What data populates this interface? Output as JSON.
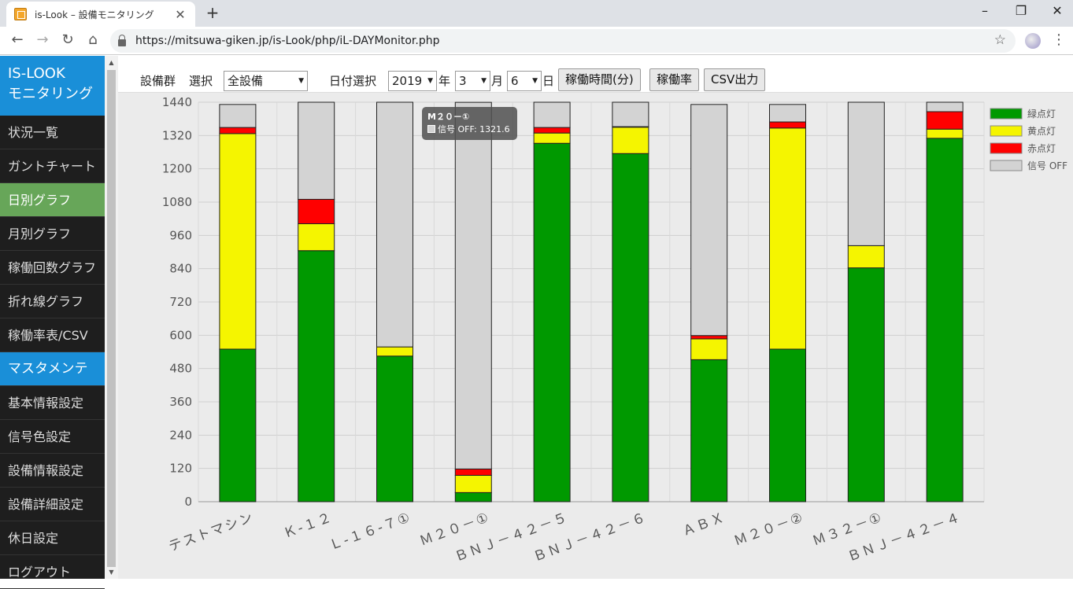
{
  "browser": {
    "tab_title": "is-Look – 設備モニタリング",
    "url": "https://mitsuwa-giken.jp/is-Look/php/iL-DAYMonitor.php"
  },
  "sidebar": {
    "title_line1": "IS-LOOK",
    "title_line2": "モニタリング",
    "items": [
      "状況一覧",
      "ガントチャート",
      "日別グラフ",
      "月別グラフ",
      "稼働回数グラフ",
      "折れ線グラフ",
      "稼働率表/CSV"
    ],
    "active_index": 2,
    "section2": "マスタメンテ",
    "items2": [
      "基本情報設定",
      "信号色設定",
      "設備情報設定",
      "設備詳細設定",
      "休日設定",
      "ログアウト"
    ]
  },
  "controls": {
    "group_label": "設備群",
    "select_label": "選択",
    "group_value": "全設備",
    "date_label": "日付選択",
    "year": "2019",
    "year_unit": "年",
    "month": "3",
    "month_unit": "月",
    "day": "6",
    "day_unit": "日",
    "btn_time": "稼働時間(分)",
    "btn_rate": "稼働率",
    "btn_csv": "CSV出力"
  },
  "tooltip": {
    "title": "M２０－①",
    "line": "信号 OFF: 1321.6"
  },
  "colors": {
    "green": "#009900",
    "yellow": "#f5f500",
    "red": "#ff0000",
    "off": "#d3d3d3"
  },
  "chart_data": {
    "type": "bar",
    "stacked": true,
    "categories": [
      "テストマシン",
      "Ｋ-１２",
      "Ｌ-１６-７①",
      "Ｍ２０－①",
      "ＢＮＪ－４２－５",
      "ＢＮＪ－４２－６",
      "ＡＢＸ",
      "Ｍ２０－②",
      "Ｍ３２－①",
      "ＢＮＪ－４２－４"
    ],
    "series": [
      {
        "name": "緑点灯",
        "color": "#009900",
        "values": [
          550,
          905,
          525,
          33,
          1292,
          1255,
          512,
          550,
          843,
          1310
        ]
      },
      {
        "name": "黄点灯",
        "color": "#f5f500",
        "values": [
          777,
          97,
          33,
          62,
          37,
          95,
          75,
          797,
          80,
          33
        ]
      },
      {
        "name": "赤点灯",
        "color": "#ff0000",
        "values": [
          22,
          88,
          0,
          23,
          20,
          2,
          12,
          22,
          0,
          63
        ]
      },
      {
        "name": "信号 OFF",
        "color": "#d3d3d3",
        "values": [
          83,
          350,
          882,
          1321.6,
          91,
          88,
          833,
          63,
          517,
          34
        ]
      }
    ],
    "ylim": [
      0,
      1440
    ],
    "yticks": [
      0,
      120,
      240,
      360,
      480,
      600,
      720,
      840,
      960,
      1080,
      1200,
      1320,
      1440
    ],
    "grid": true,
    "legend_position": "top-right"
  }
}
